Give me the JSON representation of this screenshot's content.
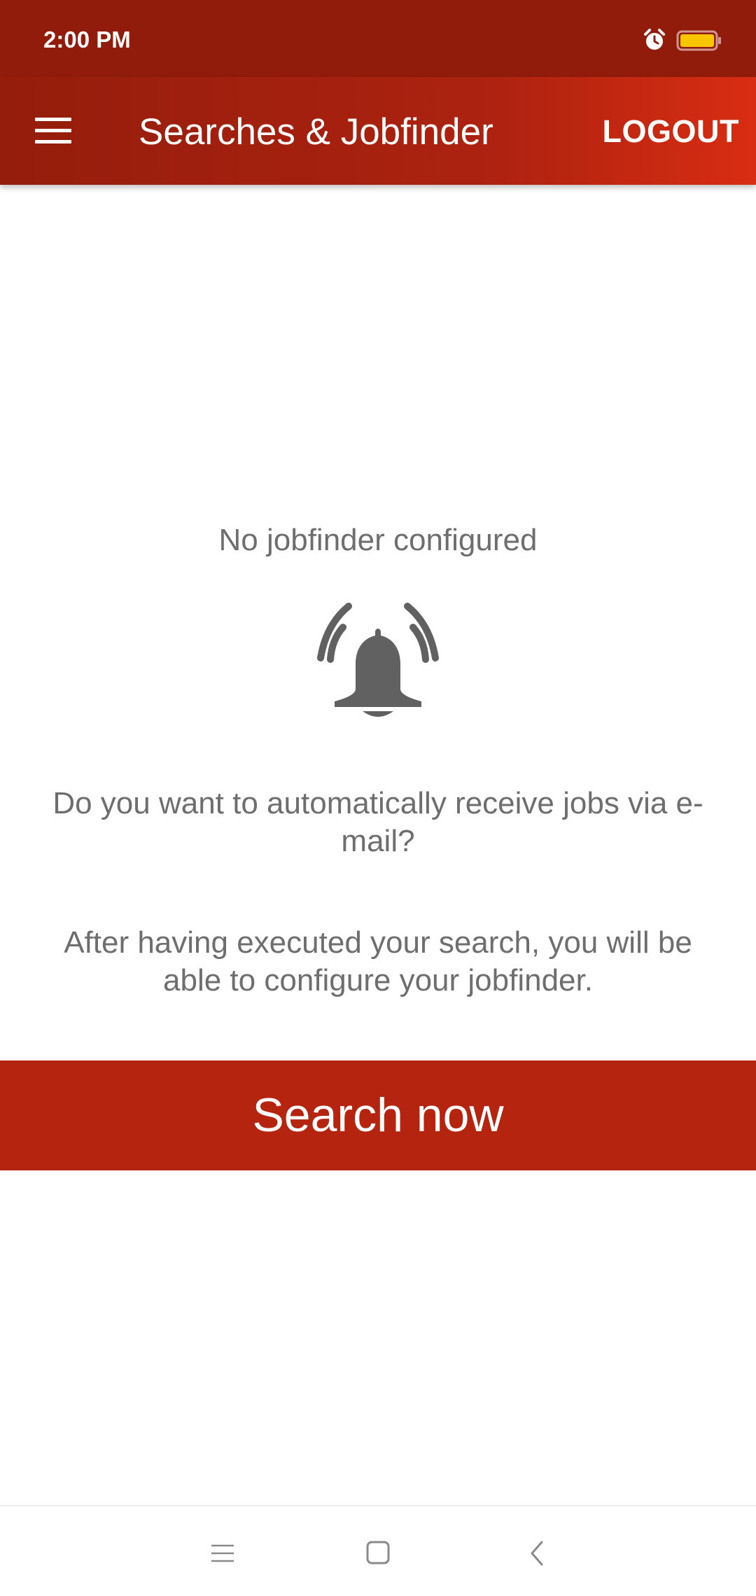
{
  "status_bar": {
    "time": "2:00 PM",
    "icons": [
      "alarm-icon",
      "battery-icon"
    ],
    "battery_color": "#f7c600",
    "background": "#921c0b"
  },
  "app_bar": {
    "menu_icon": "hamburger-menu-icon",
    "title": "Searches & Jobfinder",
    "logout_label": "LOGOUT"
  },
  "empty_state": {
    "title": "No jobfinder configured",
    "icon": "ringing-bell-icon",
    "question": "Do you want to automatically receive jobs via e-mail?",
    "info": "After having executed your search, you will be able to configure your jobfinder."
  },
  "search_button": {
    "label": "Search now",
    "color": "#b4240f"
  },
  "nav_bar": {
    "icons": [
      "recents-icon",
      "home-icon",
      "back-icon"
    ]
  },
  "colors": {
    "accent": "#b4240f",
    "text_muted": "#6e6e6e",
    "icon_gray": "#616161"
  }
}
